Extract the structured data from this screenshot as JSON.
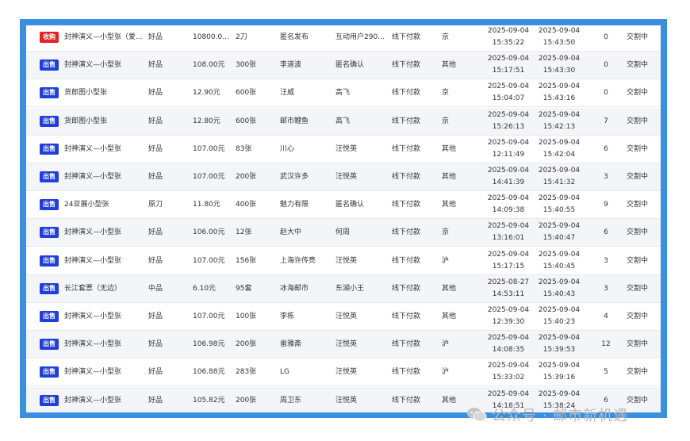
{
  "rows": [
    {
      "type": "收购",
      "type_kind": "buy",
      "name": "封神演义—小型张（爱...",
      "quality": "好品",
      "price": "10800.0...",
      "qty": "2刀",
      "seller": "匿名发布",
      "buyer": "互动用户290...",
      "pay": "线下付款",
      "region": "京",
      "created_date": "2025-09-04",
      "created_time": "15:35:22",
      "updated_date": "2025-09-04",
      "updated_time": "15:43:50",
      "count": "0",
      "status": "交割中"
    },
    {
      "type": "出售",
      "type_kind": "sell",
      "name": "封神演义—小型张",
      "quality": "好品",
      "price": "108.00元",
      "qty": "300张",
      "seller": "李道波",
      "buyer": "匿名确认",
      "pay": "线下付款",
      "region": "其他",
      "created_date": "2025-09-04",
      "created_time": "15:17:51",
      "updated_date": "2025-09-04",
      "updated_time": "15:43:30",
      "count": "0",
      "status": "交割中"
    },
    {
      "type": "出售",
      "type_kind": "sell",
      "name": "货郎图小型张",
      "quality": "好品",
      "price": "12.90元",
      "qty": "600张",
      "seller": "汪威",
      "buyer": "高飞",
      "pay": "线下付款",
      "region": "京",
      "created_date": "2025-09-04",
      "created_time": "15:04:07",
      "updated_date": "2025-09-04",
      "updated_time": "15:43:16",
      "count": "0",
      "status": "交割中"
    },
    {
      "type": "出售",
      "type_kind": "sell",
      "name": "货郎图小型张",
      "quality": "好品",
      "price": "12.80元",
      "qty": "600张",
      "seller": "邮市鲤鱼",
      "buyer": "高飞",
      "pay": "线下付款",
      "region": "京",
      "created_date": "2025-09-04",
      "created_time": "15:26:13",
      "updated_date": "2025-09-04",
      "updated_time": "15:42:13",
      "count": "7",
      "status": "交割中"
    },
    {
      "type": "出售",
      "type_kind": "sell",
      "name": "封神演义—小型张",
      "quality": "好品",
      "price": "107.00元",
      "qty": "83张",
      "seller": "川心",
      "buyer": "汪悦英",
      "pay": "线下付款",
      "region": "其他",
      "created_date": "2025-09-04",
      "created_time": "12:11:49",
      "updated_date": "2025-09-04",
      "updated_time": "15:42:04",
      "count": "6",
      "status": "交割中"
    },
    {
      "type": "出售",
      "type_kind": "sell",
      "name": "封神演义—小型张",
      "quality": "好品",
      "price": "107.00元",
      "qty": "200张",
      "seller": "武汉许多",
      "buyer": "汪悦英",
      "pay": "线下付款",
      "region": "其他",
      "created_date": "2025-09-04",
      "created_time": "14:41:39",
      "updated_date": "2025-09-04",
      "updated_time": "15:41:32",
      "count": "3",
      "status": "交割中"
    },
    {
      "type": "出售",
      "type_kind": "sell",
      "name": "24亚展小型张",
      "quality": "原刀",
      "price": "11.80元",
      "qty": "400张",
      "seller": "魅力有限",
      "buyer": "匿名确认",
      "pay": "线下付款",
      "region": "其他",
      "created_date": "2025-09-04",
      "created_time": "14:09:38",
      "updated_date": "2025-09-04",
      "updated_time": "15:40:55",
      "count": "9",
      "status": "交割中"
    },
    {
      "type": "出售",
      "type_kind": "sell",
      "name": "封神演义—小型张",
      "quality": "好品",
      "price": "106.00元",
      "qty": "12张",
      "seller": "赵大中",
      "buyer": "何周",
      "pay": "线下付款",
      "region": "京",
      "created_date": "2025-09-04",
      "created_time": "13:16:01",
      "updated_date": "2025-09-04",
      "updated_time": "15:40:47",
      "count": "6",
      "status": "交割中"
    },
    {
      "type": "出售",
      "type_kind": "sell",
      "name": "封神演义—小型张",
      "quality": "好品",
      "price": "107.00元",
      "qty": "156张",
      "seller": "上海许传亮",
      "buyer": "汪悦英",
      "pay": "线下付款",
      "region": "沪",
      "created_date": "2025-09-04",
      "created_time": "15:17:15",
      "updated_date": "2025-09-04",
      "updated_time": "15:40:45",
      "count": "3",
      "status": "交割中"
    },
    {
      "type": "出售",
      "type_kind": "sell",
      "name": "长江套票（无边）",
      "quality": "中品",
      "price": "6.10元",
      "qty": "95套",
      "seller": "冰海邮市",
      "buyer": "东湖小王",
      "pay": "线下付款",
      "region": "其他",
      "created_date": "2025-08-27",
      "created_time": "14:53:11",
      "updated_date": "2025-09-04",
      "updated_time": "15:40:43",
      "count": "3",
      "status": "交割中"
    },
    {
      "type": "出售",
      "type_kind": "sell",
      "name": "封神演义—小型张",
      "quality": "好品",
      "price": "107.00元",
      "qty": "100张",
      "seller": "李栋",
      "buyer": "汪悦英",
      "pay": "线下付款",
      "region": "其他",
      "created_date": "2025-09-04",
      "created_time": "12:39:30",
      "updated_date": "2025-09-04",
      "updated_time": "15:40:23",
      "count": "4",
      "status": "交割中"
    },
    {
      "type": "出售",
      "type_kind": "sell",
      "name": "封神演义—小型张",
      "quality": "好品",
      "price": "106.98元",
      "qty": "200张",
      "seller": "畲雅斋",
      "buyer": "汪悦英",
      "pay": "线下付款",
      "region": "沪",
      "created_date": "2025-09-04",
      "created_time": "14:08:35",
      "updated_date": "2025-09-04",
      "updated_time": "15:39:53",
      "count": "12",
      "status": "交割中"
    },
    {
      "type": "出售",
      "type_kind": "sell",
      "name": "封神演义—小型张",
      "quality": "好品",
      "price": "106.88元",
      "qty": "283张",
      "seller": "LG",
      "buyer": "汪悦英",
      "pay": "线下付款",
      "region": "沪",
      "created_date": "2025-09-04",
      "created_time": "15:33:02",
      "updated_date": "2025-09-04",
      "updated_time": "15:39:16",
      "count": "5",
      "status": "交割中"
    },
    {
      "type": "出售",
      "type_kind": "sell",
      "name": "封神演义—小型张",
      "quality": "好品",
      "price": "105.82元",
      "qty": "200张",
      "seller": "周卫东",
      "buyer": "汪悦英",
      "pay": "线下付款",
      "region": "其他",
      "created_date": "2025-09-04",
      "created_time": "14:18:51",
      "updated_date": "2025-09-04",
      "updated_time": "15:38:24",
      "count": "6",
      "status": "交割中"
    }
  ],
  "watermark": {
    "text": "公众号 · 邮市新机遇",
    "icon": "wechat-icon"
  },
  "colors": {
    "frame": "#3b8fe0",
    "sell_tag": "#1f3fd8",
    "buy_tag": "#e52222",
    "alt_row": "#f3f5f8"
  }
}
